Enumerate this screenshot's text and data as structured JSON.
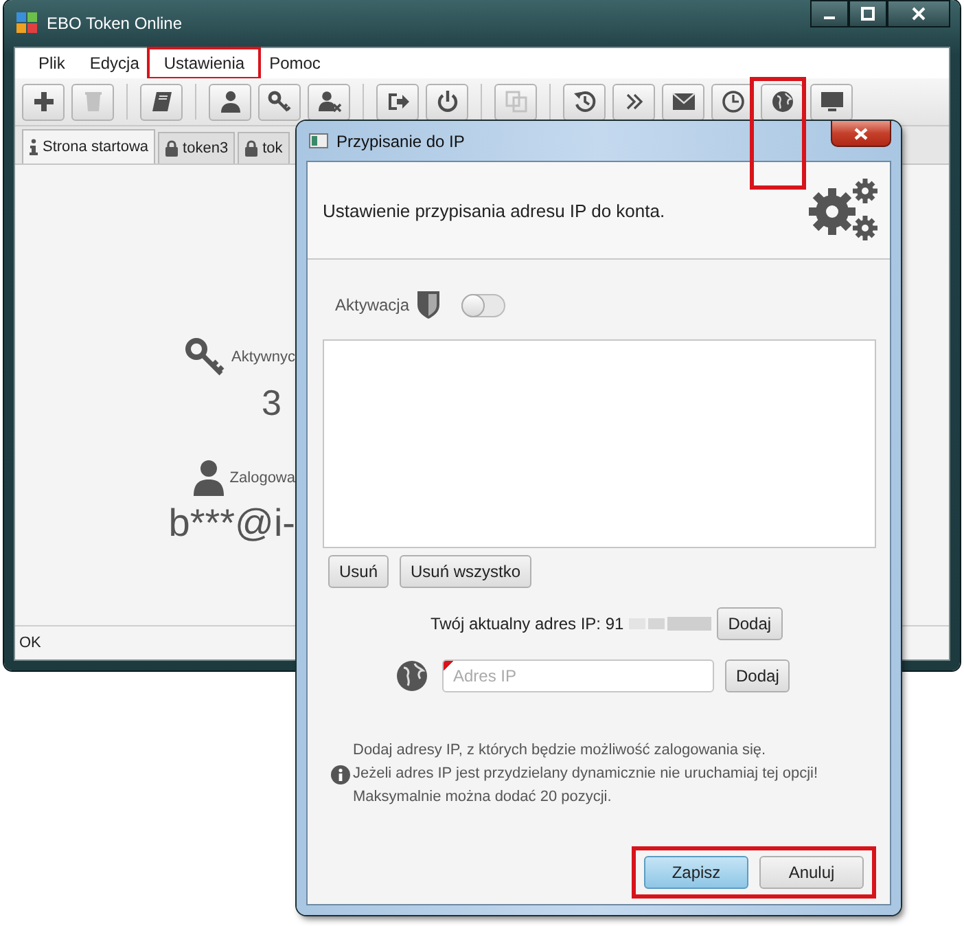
{
  "main_window": {
    "title": "EBO Token Online",
    "menu": [
      {
        "label": "Plik",
        "highlighted": false
      },
      {
        "label": "Edycja",
        "highlighted": false
      },
      {
        "label": "Ustawienia",
        "highlighted": true
      },
      {
        "label": "Pomoc",
        "highlighted": false
      }
    ],
    "toolbar_groups": [
      [
        {
          "kind": "plus",
          "disabled": false,
          "highlighted": false
        },
        {
          "kind": "trash",
          "disabled": true,
          "highlighted": false
        }
      ],
      [
        {
          "kind": "book",
          "disabled": false,
          "highlighted": false
        }
      ],
      [
        {
          "kind": "user",
          "disabled": false,
          "highlighted": false
        },
        {
          "kind": "key",
          "disabled": false,
          "highlighted": false
        },
        {
          "kind": "user-remove",
          "disabled": false,
          "highlighted": false
        }
      ],
      [
        {
          "kind": "sign-out",
          "disabled": false,
          "highlighted": false
        },
        {
          "kind": "power",
          "disabled": false,
          "highlighted": false
        }
      ],
      [
        {
          "kind": "copy",
          "disabled": true,
          "highlighted": false
        }
      ],
      [
        {
          "kind": "history",
          "disabled": false,
          "highlighted": false
        },
        {
          "kind": "chevrons",
          "disabled": false,
          "highlighted": false
        },
        {
          "kind": "envelope",
          "disabled": false,
          "highlighted": false
        },
        {
          "kind": "clock",
          "disabled": false,
          "highlighted": false
        },
        {
          "kind": "globe",
          "disabled": false,
          "highlighted": true
        },
        {
          "kind": "monitor",
          "disabled": false,
          "highlighted": false
        }
      ]
    ],
    "tabs": [
      {
        "label": "Strona startowa",
        "kind": "info",
        "selected": true
      },
      {
        "label": "token3",
        "kind": "lock",
        "selected": false
      },
      {
        "label": "tok",
        "kind": "lock",
        "selected": false
      }
    ],
    "stats": [
      {
        "kind": "key",
        "label": "Aktywnyc",
        "value": "3"
      },
      {
        "kind": "user",
        "label": "Zalogowa",
        "value": "b***@i-"
      }
    ],
    "status": "OK"
  },
  "dialog": {
    "title": "Przypisanie do IP",
    "header": "Ustawienie przypisania adresu IP do konta.",
    "activation": {
      "label": "Aktywacja",
      "on": false
    },
    "list_buttons": [
      "Usuń",
      "Usuń wszystko"
    ],
    "current_ip": {
      "label": "Twój aktualny adres IP:",
      "value": "91",
      "button": "Dodaj"
    },
    "ip_field": {
      "placeholder": "Adres IP",
      "invalid": true,
      "button": "Dodaj"
    },
    "info": [
      "Dodaj adresy IP, z których będzie możliwość zalogowania się.",
      "Jeżeli adres IP jest przydzielany dynamicznie nie uruchamiaj tej opcji!",
      "Maksymalnie można dodać 20 pozycji."
    ],
    "buttons": [
      {
        "label": "Zapisz",
        "default": true
      },
      {
        "label": "Anuluj",
        "default": false
      }
    ],
    "buttons_highlighted": true
  }
}
